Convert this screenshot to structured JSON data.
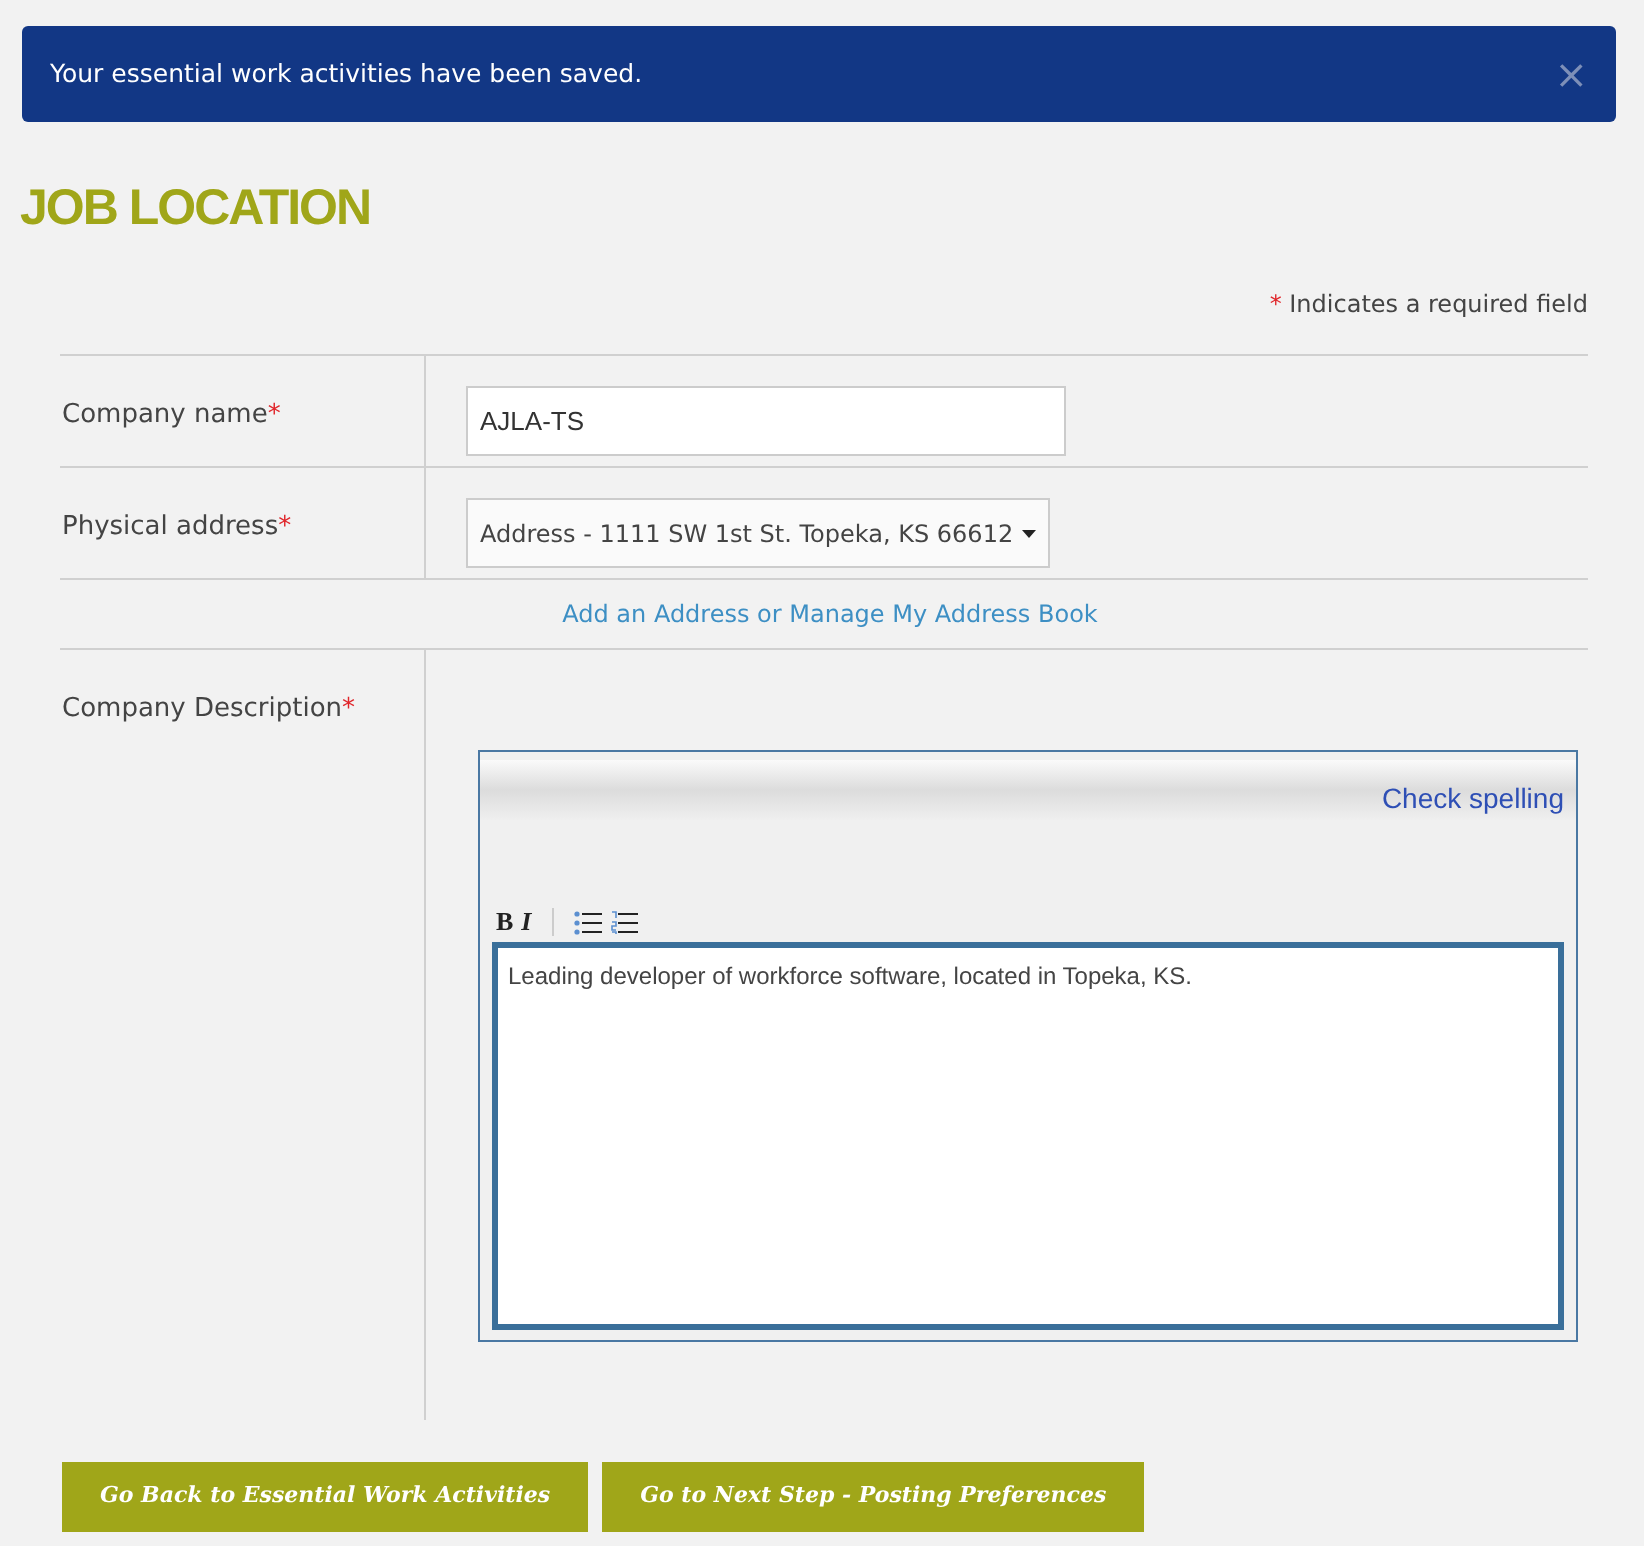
{
  "alert": {
    "message": "Your essential work activities have been saved.",
    "close": "×"
  },
  "heading": "JOB LOCATION",
  "required_note": {
    "mark": "*",
    "text": "Indicates a required field"
  },
  "company_name": {
    "label": "Company name",
    "required_mark": "*",
    "value": "AJLA-TS"
  },
  "physical_address": {
    "label": "Physical address",
    "required_mark": "*",
    "value": "Address - 1111 SW 1st St. Topeka, KS 66612"
  },
  "address_link": "Add an Address or Manage My Address Book",
  "company_description": {
    "label": "Company Description",
    "required_mark": "*",
    "check_spelling": "Check spelling",
    "toolbar": [
      "B",
      "I"
    ],
    "value": "Leading developer of workforce software, located in Topeka, KS."
  },
  "buttons": [
    "Go Back to Essential Work Activities",
    "Go to Next Step - Posting Preferences"
  ]
}
